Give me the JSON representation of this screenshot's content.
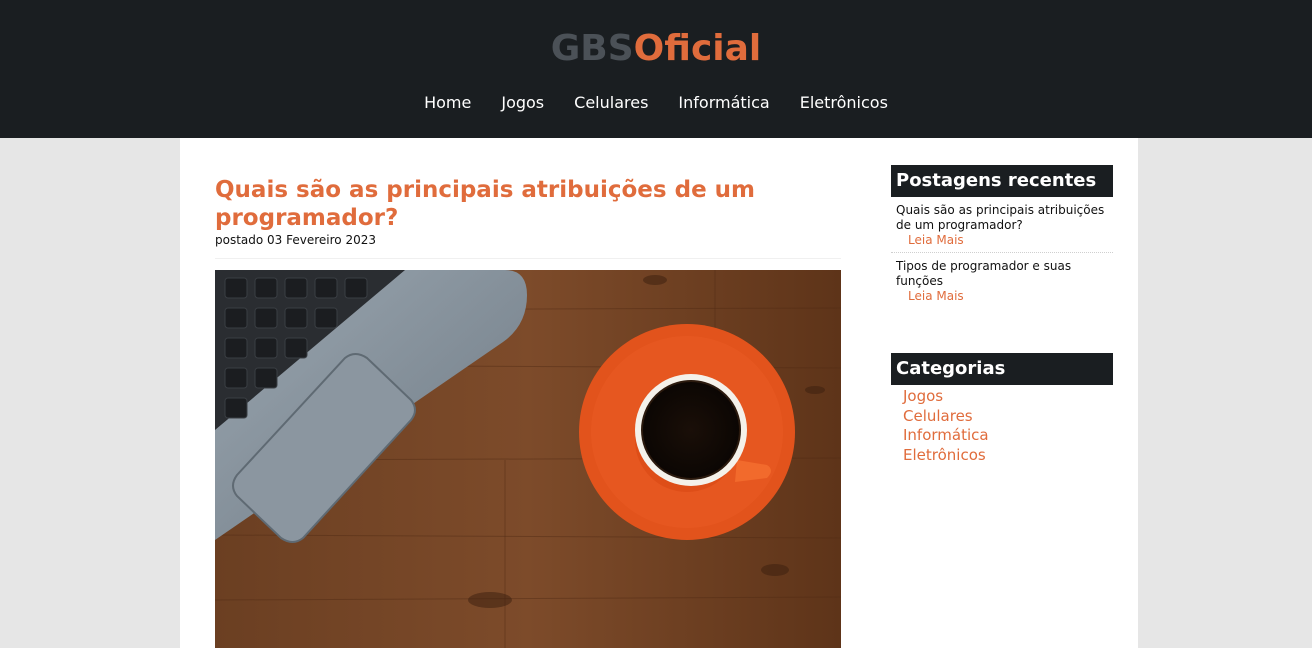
{
  "header": {
    "logo_part1": "GBS",
    "logo_part2": "Oficial",
    "nav": [
      "Home",
      "Jogos",
      "Celulares",
      "Informática",
      "Eletrônicos"
    ]
  },
  "post": {
    "title": "Quais são as principais atribuições de um programador?",
    "meta": "postado 03 Fevereiro 2023"
  },
  "sidebar": {
    "recent_title": "Postagens recentes",
    "recent": [
      {
        "title": "Quais são as principais atribuições de um programador?",
        "more": "Leia Mais"
      },
      {
        "title": "Tipos de programador e suas funções",
        "more": "Leia Mais"
      }
    ],
    "categories_title": "Categorias",
    "categories": [
      "Jogos",
      "Celulares",
      "Informática",
      "Eletrônicos"
    ]
  },
  "colors": {
    "accent": "#e06c3c",
    "header_bg": "#1a1e21",
    "logo_gray": "#4b5157"
  }
}
